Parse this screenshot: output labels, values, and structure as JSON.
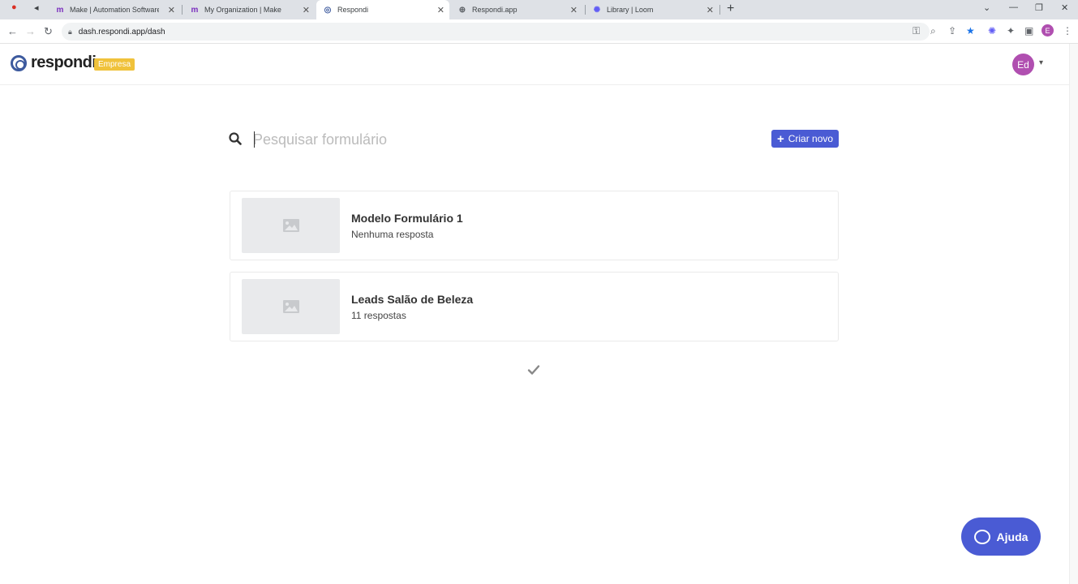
{
  "browser": {
    "tabs": [
      {
        "title": "Make | Automation Software | C",
        "icon": "make-icon"
      },
      {
        "title": "My Organization | Make",
        "icon": "make-icon"
      },
      {
        "title": "Respondi",
        "icon": "respondi-icon"
      },
      {
        "title": "Respondi.app",
        "icon": "globe-icon"
      },
      {
        "title": "Library | Loom",
        "icon": "loom-icon"
      }
    ],
    "url": "dash.respondi.app/dash",
    "profile_initial": "E"
  },
  "header": {
    "logo_text": "respondi",
    "plan_badge": "Empresa",
    "avatar_initials": "Ed"
  },
  "search": {
    "placeholder": "Pesquisar formulário",
    "value": ""
  },
  "create_button_label": "Criar novo",
  "forms": [
    {
      "title": "Modelo Formulário 1",
      "subtitle": "Nenhuma resposta"
    },
    {
      "title": "Leads Salão de Beleza",
      "subtitle": "11 respostas"
    }
  ],
  "help_button_label": "Ajuda",
  "colors": {
    "accent": "#4a5bd4",
    "badge": "#f0c23b",
    "avatar": "#b04fb0"
  }
}
